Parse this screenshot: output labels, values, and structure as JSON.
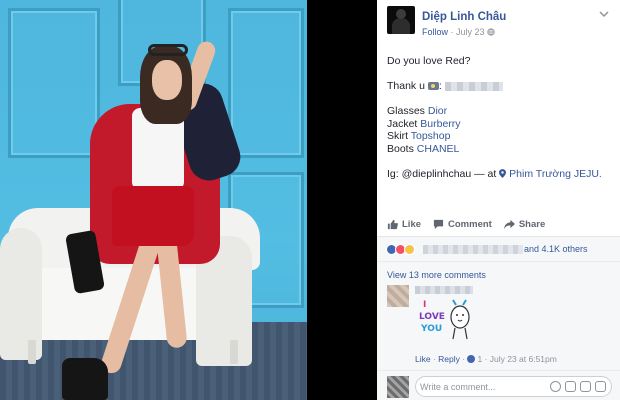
{
  "post": {
    "author": "Diệp Linh Châu",
    "follow": "Follow",
    "separator": "·",
    "date": "July 23",
    "question": "Do you love Red?",
    "thanks_prefix": "Thank u",
    "items": [
      {
        "label": "Glasses",
        "brand": "Dior"
      },
      {
        "label": "Jacket",
        "brand": "Burberry"
      },
      {
        "label": "Skirt",
        "brand": "Topshop"
      },
      {
        "label": "Boots",
        "brand": "CHANEL"
      }
    ],
    "ig_line": "Ig: @dieplinhchau — at",
    "location": "Phim Trường JEJU."
  },
  "actions": {
    "like": "Like",
    "comment": "Comment",
    "share": "Share"
  },
  "reactions": {
    "count_text": "and 4.1K others",
    "types": [
      "like",
      "love",
      "wow"
    ]
  },
  "comments": {
    "view_more": "View 13 more comments",
    "first": {
      "sticker_lines": [
        "I",
        "LOVE",
        "YOU"
      ],
      "like_label": "Like",
      "reply_label": "Reply",
      "reaction_count": "1",
      "timestamp": "July 23 at 6:51pm"
    },
    "write_placeholder": "Write a comment..."
  },
  "colors": {
    "link": "#365899",
    "muted": "#90949c",
    "like_blue": "#4267b2",
    "love_red": "#f25268",
    "wow_yellow": "#f7c24a"
  }
}
